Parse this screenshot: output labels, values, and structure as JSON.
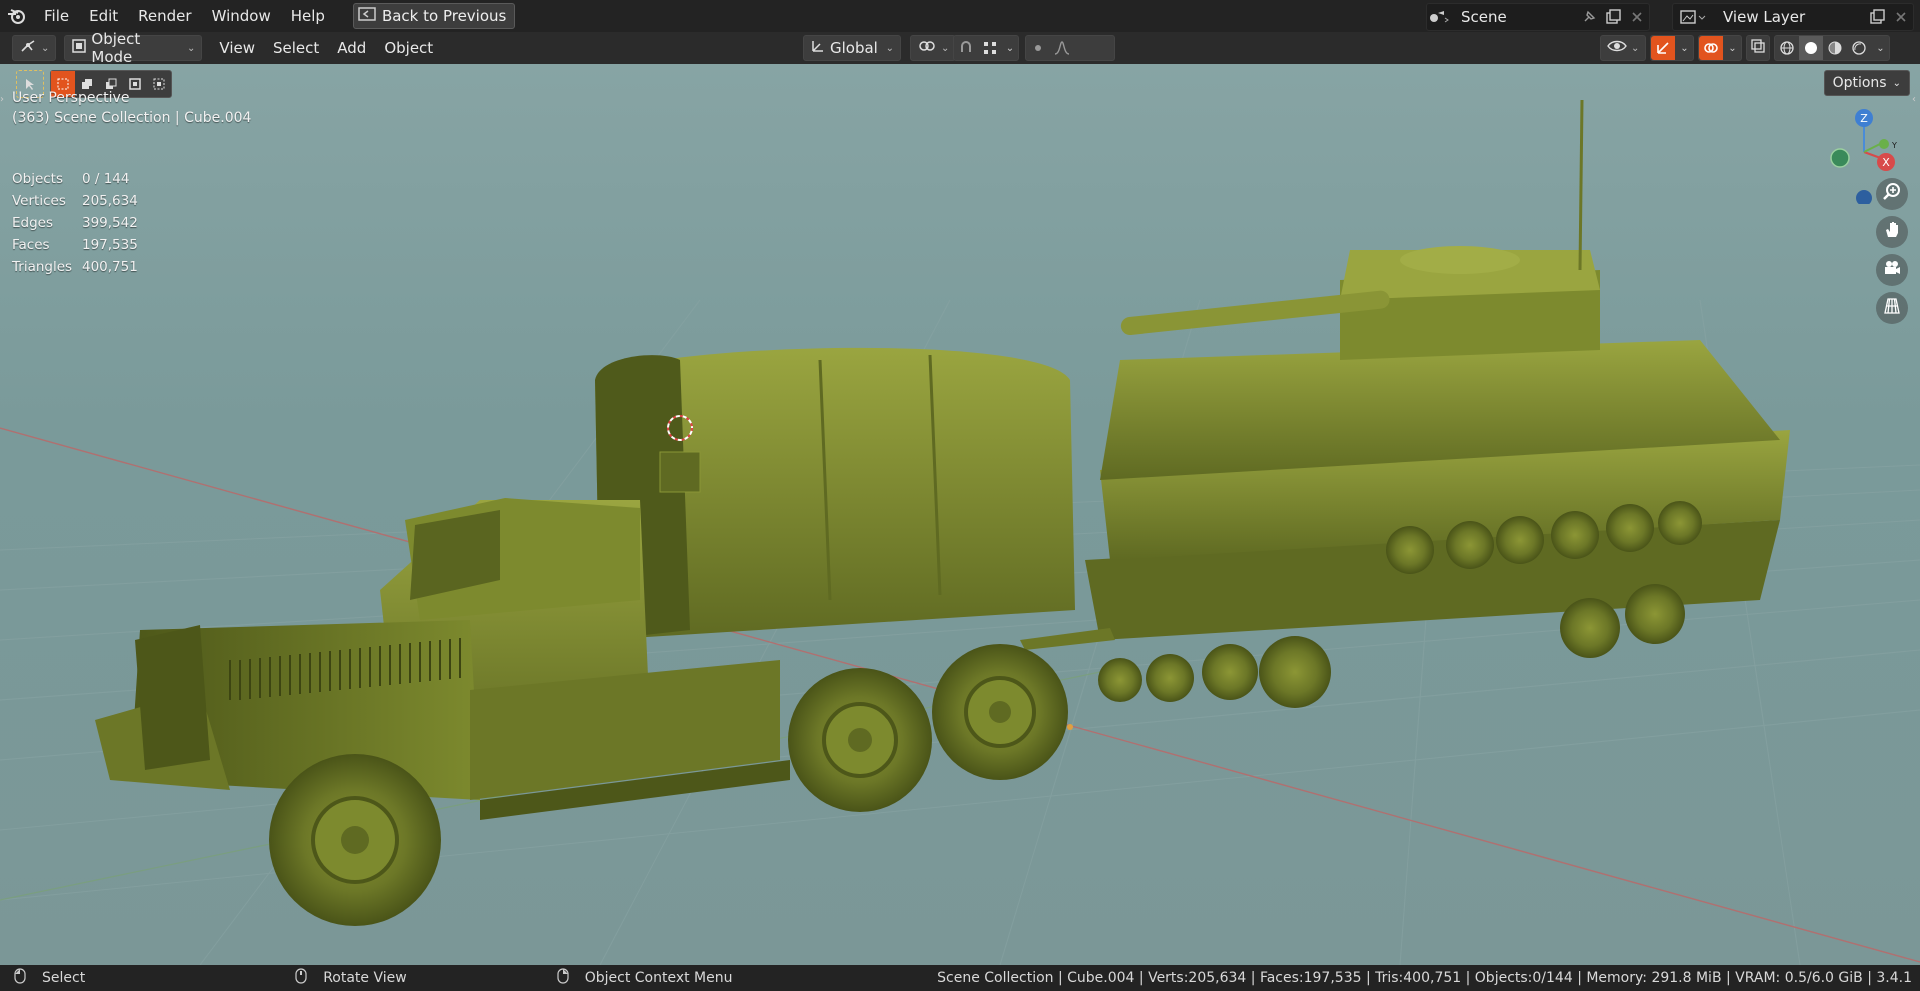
{
  "menu": {
    "file": "File",
    "edit": "Edit",
    "render": "Render",
    "window": "Window",
    "help": "Help",
    "back_to_previous": "Back to Previous"
  },
  "scene": {
    "name": "Scene"
  },
  "view_layer": {
    "name": "View Layer"
  },
  "header": {
    "mode": "Object Mode",
    "view": "View",
    "select": "Select",
    "add": "Add",
    "object": "Object",
    "orientation": "Global",
    "options": "Options"
  },
  "viewport": {
    "perspective": "User Perspective",
    "collection": "(363) Scene Collection | Cube.004",
    "stats": [
      {
        "label": "Objects",
        "value": "0 / 144"
      },
      {
        "label": "Vertices",
        "value": "205,634"
      },
      {
        "label": "Edges",
        "value": "399,542"
      },
      {
        "label": "Faces",
        "value": "197,535"
      },
      {
        "label": "Triangles",
        "value": "400,751"
      }
    ],
    "gizmo": {
      "z": "Z",
      "y": "Y",
      "x": "X"
    }
  },
  "status": {
    "select": "Select",
    "rotate": "Rotate View",
    "context": "Object Context Menu",
    "info": "Scene Collection | Cube.004 | Verts:205,634 | Faces:197,535 | Tris:400,751 | Objects:0/144 | Memory: 291.8 MiB | VRAM: 0.5/6.0 GiB | 3.4.1"
  },
  "colors": {
    "accent": "#e2541e",
    "model": "#7d8a2e",
    "viewport_bg": "#7f9c9c"
  }
}
